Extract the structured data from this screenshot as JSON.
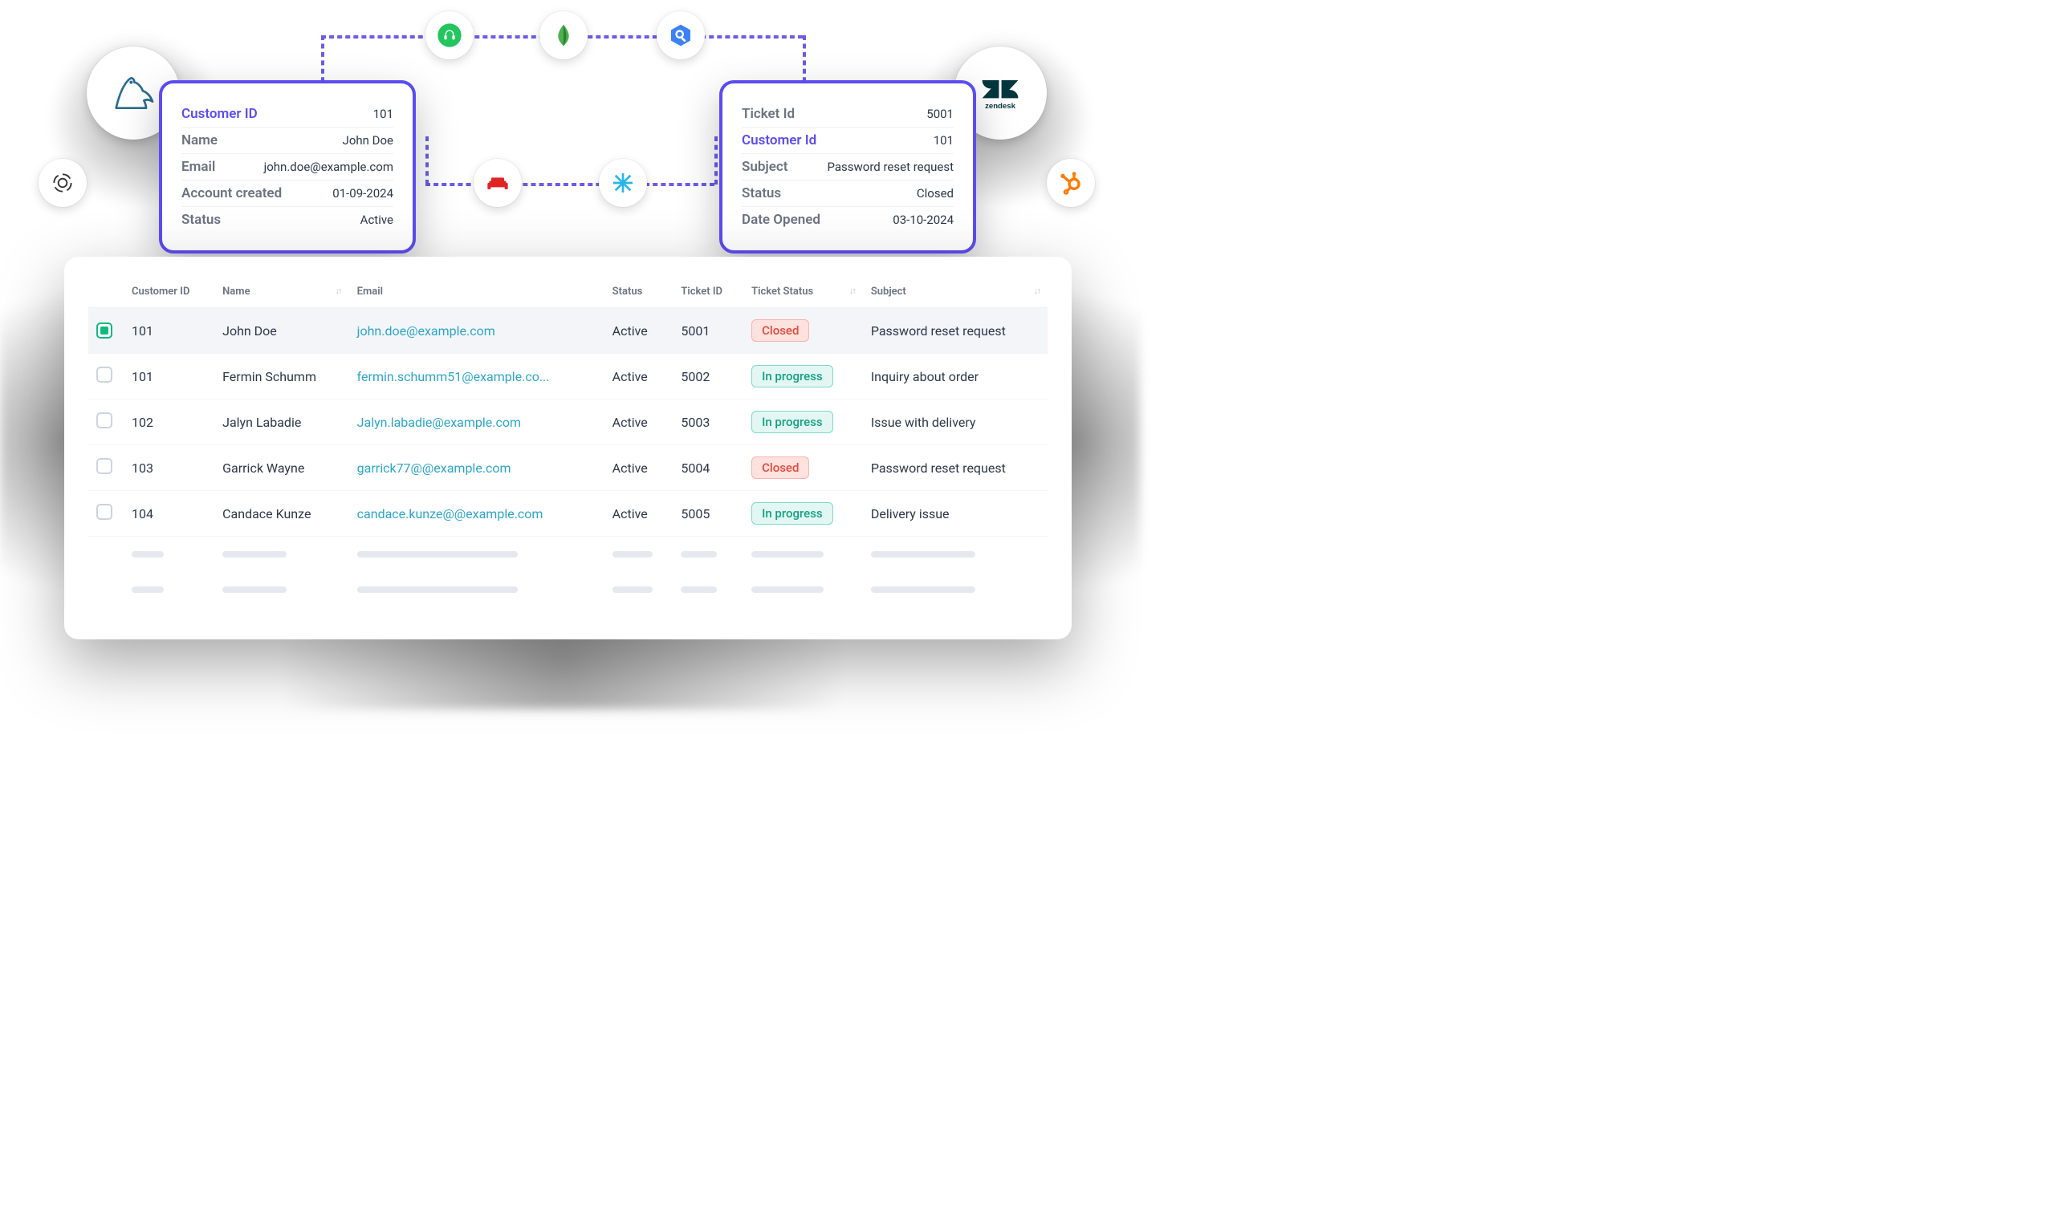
{
  "customer_card": {
    "fields": [
      {
        "label": "Customer ID",
        "value": "101",
        "highlight": true
      },
      {
        "label": "Name",
        "value": "John Doe"
      },
      {
        "label": "Email",
        "value": "john.doe@example.com"
      },
      {
        "label": "Account created",
        "value": "01-09-2024"
      },
      {
        "label": "Status",
        "value": "Active"
      }
    ]
  },
  "ticket_card": {
    "fields": [
      {
        "label": "Ticket Id",
        "value": "5001"
      },
      {
        "label": "Customer Id",
        "value": "101",
        "highlight": true
      },
      {
        "label": "Subject",
        "value": "Password reset request"
      },
      {
        "label": "Status",
        "value": "Closed"
      },
      {
        "label": "Date Opened",
        "value": "03-10-2024"
      }
    ]
  },
  "integrations": {
    "mysql": "mysql-icon",
    "zendesk_label": "zendesk",
    "openai": "openai-icon",
    "hubspot": "hubspot-icon",
    "freshdesk": "freshdesk-icon",
    "mongo": "mongo-icon",
    "bigquery": "bigquery-icon",
    "couch": "couch-icon",
    "snowflake": "snowflake-icon"
  },
  "table": {
    "headers": {
      "customer_id": "Customer ID",
      "name": "Name",
      "email": "Email",
      "status": "Status",
      "ticket_id": "Ticket ID",
      "ticket_status": "Ticket Status",
      "subject": "Subject"
    },
    "rows": [
      {
        "selected": true,
        "customer_id": "101",
        "name": "John Doe",
        "email": "john.doe@example.com",
        "status": "Active",
        "ticket_id": "5001",
        "ticket_status": "Closed",
        "subject": "Password reset request"
      },
      {
        "selected": false,
        "customer_id": "101",
        "name": "Fermin Schumm",
        "email": "fermin.schumm51@example.co...",
        "status": "Active",
        "ticket_id": "5002",
        "ticket_status": "In progress",
        "subject": "Inquiry about order"
      },
      {
        "selected": false,
        "customer_id": "102",
        "name": "Jalyn Labadie",
        "email": "Jalyn.labadie@example.com",
        "status": "Active",
        "ticket_id": "5003",
        "ticket_status": "In progress",
        "subject": "Issue with delivery"
      },
      {
        "selected": false,
        "customer_id": "103",
        "name": "Garrick Wayne",
        "email": "garrick77@@example.com",
        "status": "Active",
        "ticket_id": "5004",
        "ticket_status": "Closed",
        "subject": "Password reset request"
      },
      {
        "selected": false,
        "customer_id": "104",
        "name": "Candace Kunze",
        "email": "candace.kunze@@example.com",
        "status": "Active",
        "ticket_id": "5005",
        "ticket_status": "In progress",
        "subject": "Delivery issue"
      }
    ]
  }
}
